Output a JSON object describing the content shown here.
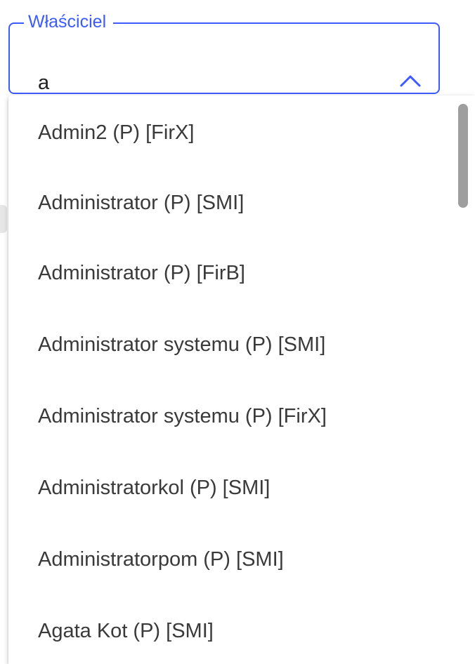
{
  "owner_field": {
    "label": "Właściciel",
    "value": "a",
    "expanded": true,
    "accent_color": "#3d5afe",
    "toggle_icon": "chevron-up-icon"
  },
  "dropdown": {
    "options": [
      {
        "label": "Admin2 (P) [FirX]"
      },
      {
        "label": "Administrator (P) [SMI]"
      },
      {
        "label": "Administrator (P) [FirB]"
      },
      {
        "label": "Administrator systemu (P) [SMI]"
      },
      {
        "label": "Administrator systemu (P) [FirX]"
      },
      {
        "label": "Administratorkol (P) [SMI]"
      },
      {
        "label": "Administratorpom (P) [SMI]"
      },
      {
        "label": "Agata Kot (P) [SMI]"
      }
    ]
  }
}
